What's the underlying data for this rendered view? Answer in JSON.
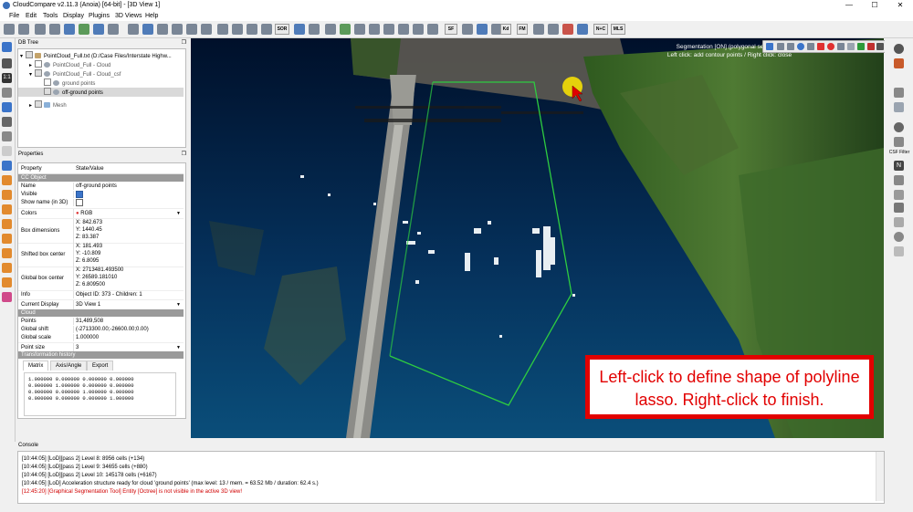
{
  "window": {
    "title": "CloudCompare v2.11.3 (Anoia) [64-bit] - [3D View 1]",
    "minimize": "—",
    "maximize": "☐",
    "close": "✕"
  },
  "menu": [
    "File",
    "Edit",
    "Tools",
    "Display",
    "Plugins",
    "3D Views",
    "Help"
  ],
  "toolbar": {
    "sor_label": "SOR",
    "sf_label": "SF",
    "kd_label": "Kd",
    "fm_label": "FM",
    "nc_label": "N+C",
    "mls_label": "MLS"
  },
  "db_tree": {
    "header": "DB Tree",
    "nodes": [
      {
        "label": "PointCloud_Full.txt (D:/Case Files/Interstate Highw...",
        "indent": 0,
        "expanded": true
      },
      {
        "label": "PointCloud_Full - Cloud",
        "indent": 1
      },
      {
        "label": "PointCloud_Full - Cloud_csf",
        "indent": 1,
        "expanded": true
      },
      {
        "label": "ground points",
        "indent": 2
      },
      {
        "label": "off-ground points",
        "indent": 2,
        "selected": true
      },
      {
        "label": "Mesh",
        "indent": 1
      }
    ]
  },
  "properties": {
    "header": "Properties",
    "col_property": "Property",
    "col_value": "State/Value",
    "sec_ccobject": "CC Object",
    "name_k": "Name",
    "name_v": "off-ground points",
    "visible_k": "Visible",
    "showname_k": "Show name (in 3D)",
    "colors_k": "Colors",
    "colors_v": "RGB",
    "boxdim_k": "Box dimensions",
    "boxdim_x": "X: 842.673",
    "boxdim_y": "Y: 1440.45",
    "boxdim_z": "Z: 83.387",
    "shifted_k": "Shifted box center",
    "shifted_x": "X: 181.493",
    "shifted_y": "Y: -10.809",
    "shifted_z": "Z: 6.8095",
    "global_k": "Global box center",
    "global_x": "X: 2713481.493500",
    "global_y": "Y: 26589.181010",
    "global_z": "Z: 6.809500",
    "info_k": "Info",
    "info_v": "Object ID: 373 - Children: 1",
    "display_k": "Current Display",
    "display_v": "3D View 1",
    "sec_cloud": "Cloud",
    "points_k": "Points",
    "points_v": "31,489,508",
    "gshift_k": "Global shift",
    "gshift_v": "(-2713300.00;-26600.00;0.00)",
    "gscale_k": "Global scale",
    "gscale_v": "1.000000",
    "psize_k": "Point size",
    "psize_v": "3",
    "sec_transform": "Transformation history",
    "tabs": [
      "Matrix",
      "Axis/Angle",
      "Export"
    ],
    "matrix": [
      "1.000000 0.000000 0.000000 0.000000",
      "0.000000 1.000000 0.000000 0.000000",
      "0.000000 0.000000 1.000000 0.000000",
      "0.000000 0.000000 0.000000 1.000000"
    ]
  },
  "view": {
    "seg_line1": "Segmentation [ON] (polygonal selection)",
    "seg_line2": "Left click: add contour points / Right click: close",
    "callout": "Left-click to define shape of polyline lasso. Right-click to finish.",
    "csf_label": "CSF Filter"
  },
  "console": {
    "header": "Console",
    "lines": [
      {
        "text": "[10:44:05] [LoD][pass 2] Level 8: 8956 cells (+134)",
        "error": false
      },
      {
        "text": "[10:44:05] [LoD][pass 2] Level 9: 34655 cells (+880)",
        "error": false
      },
      {
        "text": "[10:44:05] [LoD][pass 2] Level 10: 145178 cells (+6167)",
        "error": false
      },
      {
        "text": "[10:44:05] [LoD] Acceleration structure ready for cloud 'ground points' (max level: 13 / mem. = 63.52 Mb / duration: 62.4 s.)",
        "error": false
      },
      {
        "text": "[12:45:20] [Graphical Segmentation Tool] Entity [Octree] is not visible in the active 3D view!",
        "error": true
      }
    ]
  },
  "colors": {
    "accent": "#e20000",
    "lasso": "#2ecc40",
    "selection": "#d9d9d9"
  }
}
